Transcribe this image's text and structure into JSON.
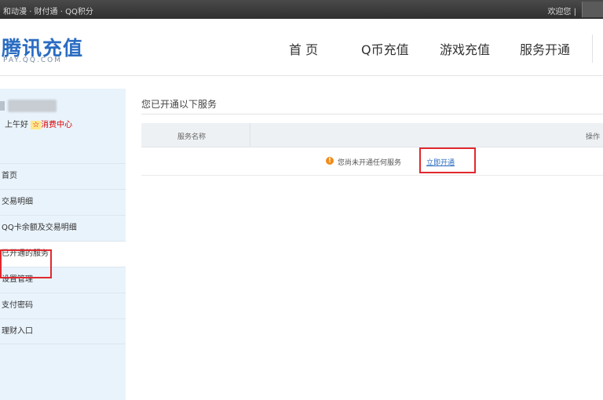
{
  "topbar": {
    "left_text": "和动漫 · 财付通 · QQ积分",
    "right_text": "欢迎您 |"
  },
  "header": {
    "logo_title": "腾讯充值",
    "logo_sub": "PAY.QQ.COM",
    "nav": [
      {
        "label": "首 页"
      },
      {
        "label": "Q币充值"
      },
      {
        "label": "游戏充值"
      },
      {
        "label": "服务开通"
      }
    ]
  },
  "sidebar": {
    "greeting_prefix": "上午好",
    "greeting_badge": "☆",
    "greeting_link": "消费中心",
    "items": [
      {
        "label": "首页"
      },
      {
        "label": "交易明细"
      },
      {
        "label": "QQ卡余额及交易明细"
      },
      {
        "label": "已开通的服务"
      },
      {
        "label": "设置管理"
      },
      {
        "label": "支付密码"
      },
      {
        "label": "理财入口"
      }
    ]
  },
  "main": {
    "title": "您已开通以下服务",
    "table": {
      "col_name": "服务名称",
      "col_right": "操作"
    },
    "notice_icon": "!",
    "notice_text": "您尚未开通任何服务",
    "open_link": "立即开通"
  },
  "colors": {
    "accent_blue": "#2a6cc2",
    "highlight_red": "#e0292e",
    "sidebar_bg": "#e9f3fb"
  }
}
